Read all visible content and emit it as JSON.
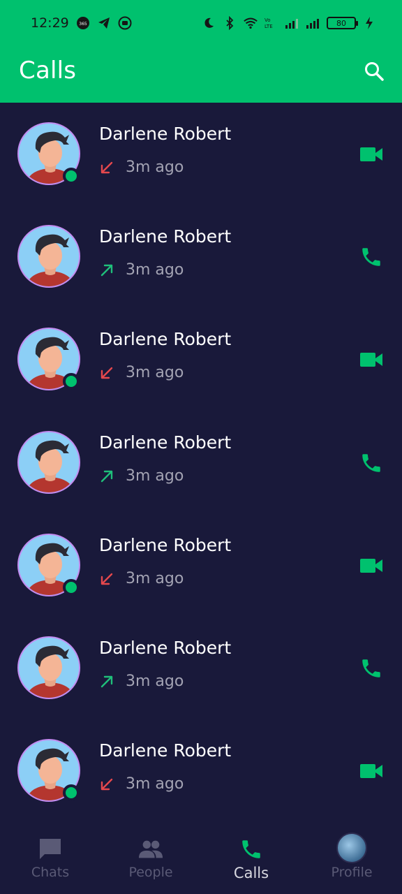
{
  "status_bar": {
    "time": "12:29",
    "battery": "80"
  },
  "header": {
    "title": "Calls"
  },
  "calls": [
    {
      "name": "Darlene Robert",
      "time": "3m ago",
      "direction": "incoming-missed",
      "type": "video",
      "online": true
    },
    {
      "name": "Darlene Robert",
      "time": "3m ago",
      "direction": "outgoing",
      "type": "voice",
      "online": false
    },
    {
      "name": "Darlene Robert",
      "time": "3m ago",
      "direction": "incoming-missed",
      "type": "video",
      "online": true
    },
    {
      "name": "Darlene Robert",
      "time": "3m ago",
      "direction": "outgoing",
      "type": "voice",
      "online": false
    },
    {
      "name": "Darlene Robert",
      "time": "3m ago",
      "direction": "incoming-missed",
      "type": "video",
      "online": true
    },
    {
      "name": "Darlene Robert",
      "time": "3m ago",
      "direction": "outgoing",
      "type": "voice",
      "online": false
    },
    {
      "name": "Darlene Robert",
      "time": "3m ago",
      "direction": "incoming-missed",
      "type": "video",
      "online": true
    }
  ],
  "bottom_nav": {
    "items": [
      {
        "label": "Chats",
        "icon": "chat-icon"
      },
      {
        "label": "People",
        "icon": "people-icon"
      },
      {
        "label": "Calls",
        "icon": "phone-icon",
        "active": true
      },
      {
        "label": "Profile",
        "icon": "profile-avatar"
      }
    ]
  },
  "colors": {
    "brand": "#00c16e",
    "background": "#19193a",
    "missed": "#e5484d",
    "outgoing": "#1fbf7a"
  }
}
